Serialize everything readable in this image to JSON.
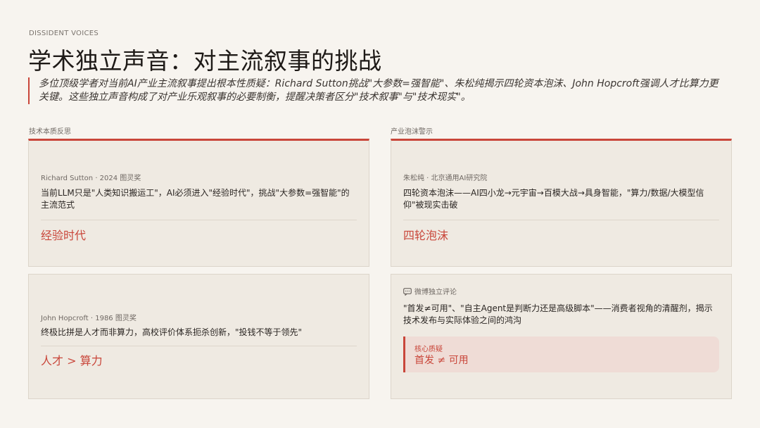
{
  "header": {
    "eyebrow": "DISSIDENT VOICES",
    "title": "学术独立声音：对主流叙事的挑战",
    "lede": "多位顶级学者对当前AI产业主流叙事提出根本性质疑：Richard Sutton挑战\"大参数=强智能\"、朱松纯揭示四轮资本泡沫、John Hopcroft强调人才比算力更关键。这些独立声音构成了对产业乐观叙事的必要制衡，提醒决策者区分\"技术叙事\"与\"技术现实\"。"
  },
  "columns": {
    "left_label": "技术本质反思",
    "right_label": "产业泡沫警示"
  },
  "cards": {
    "sutton": {
      "meta": "Richard Sutton · 2024 图灵奖",
      "quote": "当前LLM只是\"人类知识搬运工\"，AI必须进入\"经验时代\"，挑战\"大参数=强智能\"的主流范式",
      "key": "经验时代"
    },
    "zhu": {
      "meta": "朱松纯 · 北京通用AI研究院",
      "quote": "四轮资本泡沫——AI四小龙→元宇宙→百模大战→具身智能，\"算力/数据/大模型信仰\"被现实击破",
      "key": "四轮泡沫"
    },
    "hopcroft": {
      "meta": "John Hopcroft · 1986 图灵奖",
      "quote": "终极比拼是人才而非算力，高校评价体系扼杀创新，\"投钱不等于领先\"",
      "key": "人才 > 算力"
    },
    "weibo": {
      "meta": "微博独立评论",
      "quote": "\"首发≠可用\"、\"自主Agent是判断力还是高级脚本\"——消费者视角的清醒剂，揭示技术发布与实际体验之间的鸿沟",
      "callout_label": "核心质疑",
      "callout_value": "首发 ≠ 可用"
    }
  },
  "colors": {
    "accent": "#c9463a",
    "card": "#efeae2",
    "background": "#f7f4ef"
  },
  "icons": {
    "weibo": "chat-bubble-icon"
  }
}
